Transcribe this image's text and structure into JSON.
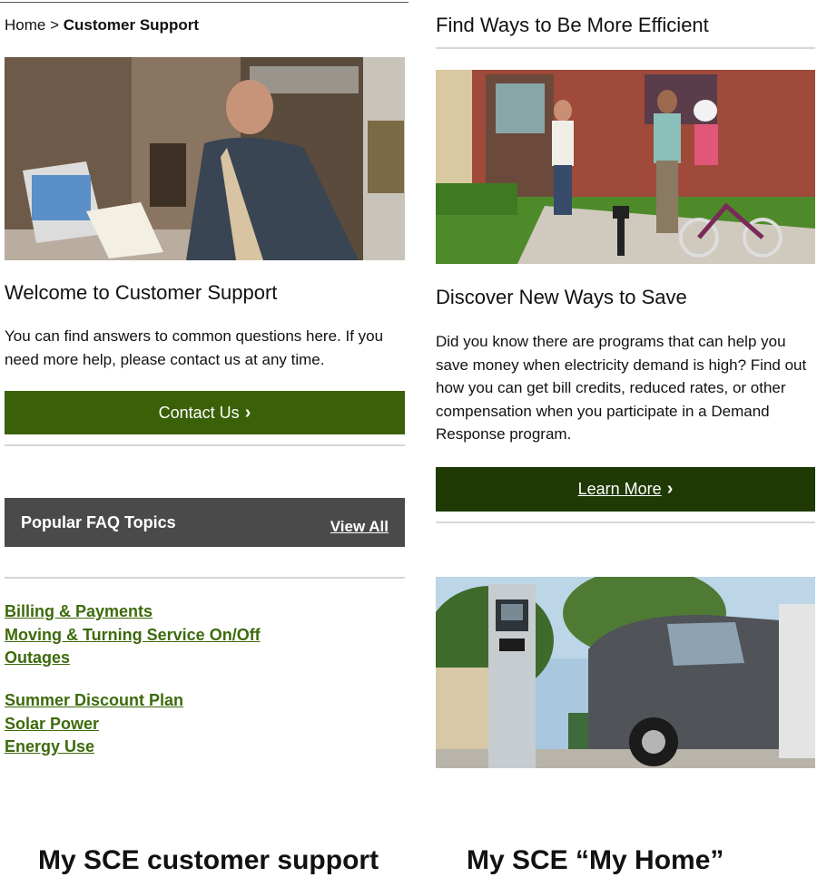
{
  "left_screen": {
    "breadcrumb": {
      "home": "Home",
      "separator": ">",
      "current": "Customer Support"
    },
    "welcome_heading": "Welcome to Customer Support",
    "welcome_text": "You can find answers to common questions here. If you need more help, please contact us at any time.",
    "contact_button": "Contact Us",
    "faq": {
      "title": "Popular FAQ Topics",
      "view_all": "View All",
      "group1": [
        "Billing & Payments",
        "Moving & Turning Service On/Off",
        "Outages"
      ],
      "group2": [
        "Summer Discount Plan",
        "Solar Power",
        "Energy Use"
      ]
    }
  },
  "right_screen": {
    "heading": "Find Ways to Be More Efficient",
    "save_heading": "Discover New Ways to Save",
    "save_text": "Did you know there are programs that can help you save money when electricity demand is high? Find out how you can get bill credits, reduced rates, or other compensation when you participate in a Demand Response program.",
    "learn_button": "Learn More"
  },
  "captions": {
    "left": "My SCE customer support",
    "right": "My SCE “My Home”"
  },
  "icons": {
    "chevron": "chevron-right-icon"
  },
  "colors": {
    "contact_button": "#3a6008",
    "learn_button": "#1f3a05",
    "faq_bar": "#4a4a4a",
    "link": "#3d6b0c"
  }
}
